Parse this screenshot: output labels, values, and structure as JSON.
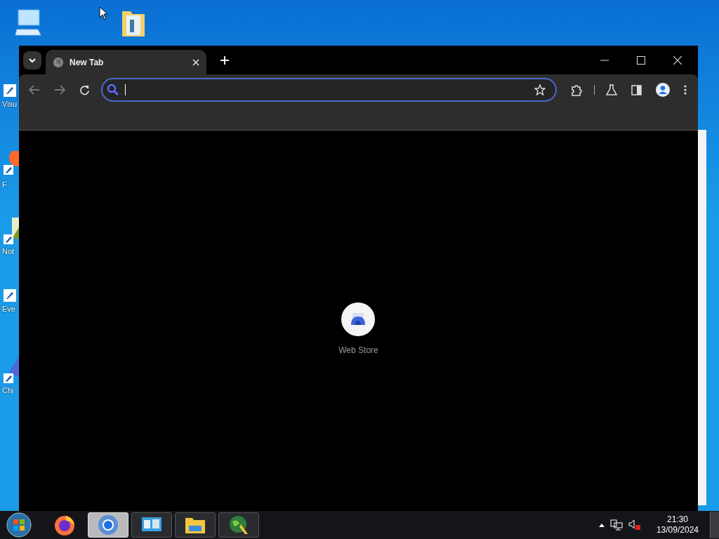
{
  "desktop": {
    "icons": [
      {
        "kind": "computer"
      },
      {
        "kind": "folder"
      },
      {
        "kind": "studio",
        "label": "Visu"
      },
      {
        "kind": "firefox",
        "label": "F"
      },
      {
        "kind": "notepad",
        "label": "Not"
      },
      {
        "kind": "viewer",
        "label": "Eve"
      },
      {
        "kind": "chrome",
        "label": "Chi"
      }
    ]
  },
  "browser": {
    "tabs": [
      {
        "title": "New Tab",
        "selected": true
      }
    ],
    "shortcuts": [
      {
        "label": "Web Store"
      }
    ]
  },
  "taskbar": {
    "items": [
      {
        "kind": "firefox",
        "selected": false
      },
      {
        "kind": "chrome",
        "selected": true
      },
      {
        "kind": "control",
        "selected": false
      },
      {
        "kind": "explorer",
        "selected": false
      },
      {
        "kind": "globe",
        "selected": false
      }
    ],
    "clock": {
      "time": "21:30",
      "date": "13/09/2024"
    }
  }
}
